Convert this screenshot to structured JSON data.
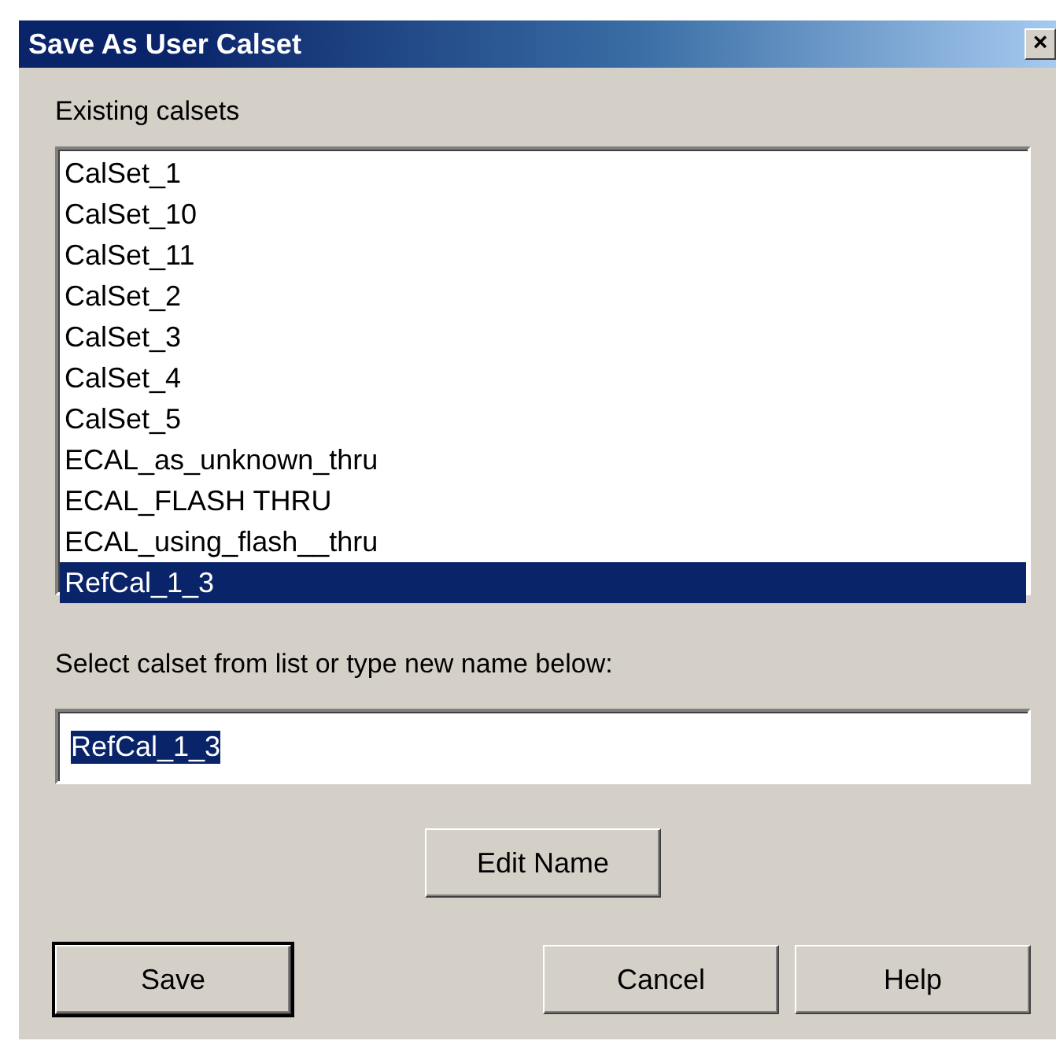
{
  "window": {
    "title": "Save As User Calset",
    "close": "×"
  },
  "list_label": "Existing calsets",
  "calsets": [
    {
      "name": "CalSet_1",
      "selected": false
    },
    {
      "name": "CalSet_10",
      "selected": false
    },
    {
      "name": "CalSet_11",
      "selected": false
    },
    {
      "name": "CalSet_2",
      "selected": false
    },
    {
      "name": "CalSet_3",
      "selected": false
    },
    {
      "name": "CalSet_4",
      "selected": false
    },
    {
      "name": "CalSet_5",
      "selected": false
    },
    {
      "name": "ECAL_as_unknown_thru",
      "selected": false
    },
    {
      "name": "ECAL_FLASH THRU",
      "selected": false
    },
    {
      "name": "ECAL_using_flash__thru",
      "selected": false
    },
    {
      "name": "RefCal_1_3",
      "selected": true
    }
  ],
  "prompt": "Select calset from list or type new name below:",
  "name_field": {
    "value": "RefCal_1_3"
  },
  "edit_button": "Edit Name",
  "buttons": [
    {
      "label": "Save",
      "default": true
    },
    {
      "label": "Cancel",
      "default": false
    },
    {
      "label": "Help",
      "default": false
    }
  ]
}
